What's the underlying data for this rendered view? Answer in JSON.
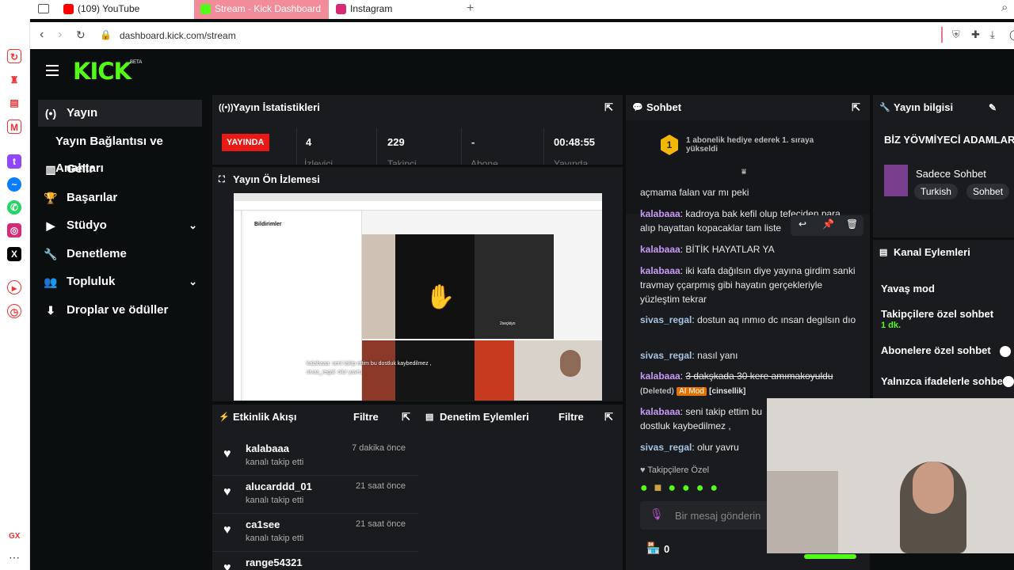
{
  "browser": {
    "tabs": [
      {
        "label": "(109) YouTube",
        "fav_color": "#ff0000"
      },
      {
        "label": "Stream - Kick Dashboard",
        "fav_color": "#53fc18"
      },
      {
        "label": "Instagram",
        "fav_color": "#d62976"
      }
    ],
    "url": "dashboard.kick.com/stream",
    "opera_label": "GX"
  },
  "brand": {
    "logo": "KICK",
    "beta": "BETA"
  },
  "nav": [
    {
      "icon": "(•)",
      "label": "Yayın",
      "active": true
    },
    {
      "icon": "",
      "label": "Yayın Bağlantısı ve Anahtarı"
    },
    {
      "icon": "▥",
      "label": "Gelir"
    },
    {
      "icon": "🏆",
      "label": "Başarılar"
    },
    {
      "icon": "▶",
      "label": "Stüdyo",
      "expand": "⌄"
    },
    {
      "icon": "🔧",
      "label": "Denetleme"
    },
    {
      "icon": "👥",
      "label": "Topluluk",
      "expand": "⌄"
    },
    {
      "icon": "⬇",
      "label": "Droplar ve ödüller"
    }
  ],
  "stats": {
    "title": "Yayın İstatistikleri",
    "live_badge": "YAYINDA",
    "viewers": "4",
    "viewers_label": "İzleyici",
    "followers": "229",
    "followers_label": "Takipçi",
    "subs": "-",
    "subs_label": "Abone",
    "duration": "00:48:55",
    "duration_label": "Yayında"
  },
  "preview": {
    "title": "Yayın Ön İzlemesi",
    "inner_title": "Bildirimler",
    "overlay_line1": "kalabaaa: seni takip ettim bu dostluk kaybedilmez ,",
    "overlay_line2": "sivas_regal: olur yavru",
    "thumb_caption": "2seçkiyo"
  },
  "activity": {
    "title": "Etkinlik Akışı",
    "filter": "Filtre",
    "items": [
      {
        "name": "kalabaaa",
        "action": "kanalı takip etti",
        "time": "7 dakika önce"
      },
      {
        "name": "alucarddd_01",
        "action": "kanalı takip etti",
        "time": "21 saat önce"
      },
      {
        "name": "ca1see",
        "action": "kanalı takip etti",
        "time": "21 saat önce"
      },
      {
        "name": "range54321",
        "action": "",
        "time": ""
      }
    ]
  },
  "moderation": {
    "title": "Denetim Eylemleri",
    "filter": "Filtre"
  },
  "chat": {
    "title": "Sohbet",
    "pinned_rank": "1",
    "pinned_text": "1 abonelik hediye ederek 1. sıraya yükseldi",
    "messages": [
      {
        "user": "",
        "text": "açmama falan var mı peki"
      },
      {
        "user": "kalabaaa",
        "text": "kadroya bak kefil olup tefeciden para alıp hayattan kopacaklar tam liste"
      },
      {
        "user": "kalabaaa",
        "text": "BİTİK HAYATLAR YA"
      },
      {
        "user": "kalabaaa",
        "text": "iki kafa dağılsın diye yayına girdim sanki travmay ççarpmış gibi hayatın gerçekleriyle yüzleştim tekrar"
      },
      {
        "user": "sivas_regal",
        "text": "dostun aq ınmıo dc ınsan degılsın dıo"
      },
      {
        "user": "sivas_regal",
        "text": "nasıl yanı"
      },
      {
        "user": "kalabaaa",
        "text": "3 dakşkada 30 kere amımakoyuldu",
        "deleted": "(Deleted)",
        "badge": "AI Mod",
        "tag": "[cinsellik]"
      },
      {
        "user": "kalabaaa",
        "text": "seni takip ettim bu dostluk kaybedilmez ,"
      },
      {
        "user": "sivas_regal",
        "text": "olur yavru"
      }
    ],
    "followers_only": "Takipçilere Özel",
    "input_placeholder": "Bir mesaj gönderin",
    "points": "0"
  },
  "stream_info": {
    "title": "Yayın bilgisi",
    "stream_title": "BİZ YÖVMİYECİ ADAMLARIZ BİZİ İZLEMEZLER",
    "category": "Sadece Sohbet",
    "tags": [
      "Turkish",
      "Sohbet"
    ]
  },
  "channel_actions": {
    "title": "Kanal Eylemleri",
    "slow_mode": "Yavaş mod",
    "followers_only": "Takipçilere özel sohbet",
    "followers_only_value": "1 dk.",
    "subs_only": "Abonelere özel sohbet",
    "emote_only": "Yalnızca ifadelerle sohbet"
  },
  "colors": {
    "kick_green": "#53fc18",
    "live_red": "#e91916",
    "panel": "#191b1f",
    "bg": "#0b0e0f"
  }
}
